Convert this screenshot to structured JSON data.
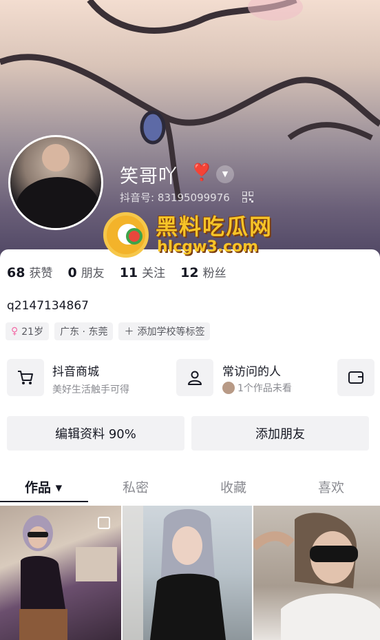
{
  "profile": {
    "nickname": "笑哥吖",
    "heart_glyph": "❣️",
    "douyin_id": "抖音号: 83195099976"
  },
  "watermark": {
    "title": "黑料吃瓜网",
    "url": "hlcgw3.com"
  },
  "stats": [
    {
      "num": "68",
      "label": "获赞"
    },
    {
      "num": "0",
      "label": "朋友"
    },
    {
      "num": "11",
      "label": "关注"
    },
    {
      "num": "12",
      "label": "粉丝"
    }
  ],
  "bio": "q2147134867",
  "tags": {
    "age": "21岁",
    "location": "广东 · 东莞",
    "add": "添加学校等标签"
  },
  "cards": {
    "shop_title": "抖音商城",
    "shop_sub": "美好生活触手可得",
    "visitors_title": "常访问的人",
    "visitors_sub": "1个作品未看"
  },
  "buttons": {
    "edit": "编辑资料 90%",
    "add_friend": "添加朋友"
  },
  "tabs": [
    "作品 ▾",
    "私密",
    "收藏",
    "喜欢"
  ],
  "icons": {
    "dropdown": "chevron-down-icon",
    "qr": "qr-code-icon",
    "cart": "cart-icon",
    "person": "person-icon",
    "wallet": "wallet-icon",
    "gender": "female-icon"
  },
  "colors": {
    "text": "#161823",
    "secondary": "#57585f",
    "muted": "#8a8b91",
    "chip": "#f2f2f4",
    "watermark": "#f7c428"
  }
}
